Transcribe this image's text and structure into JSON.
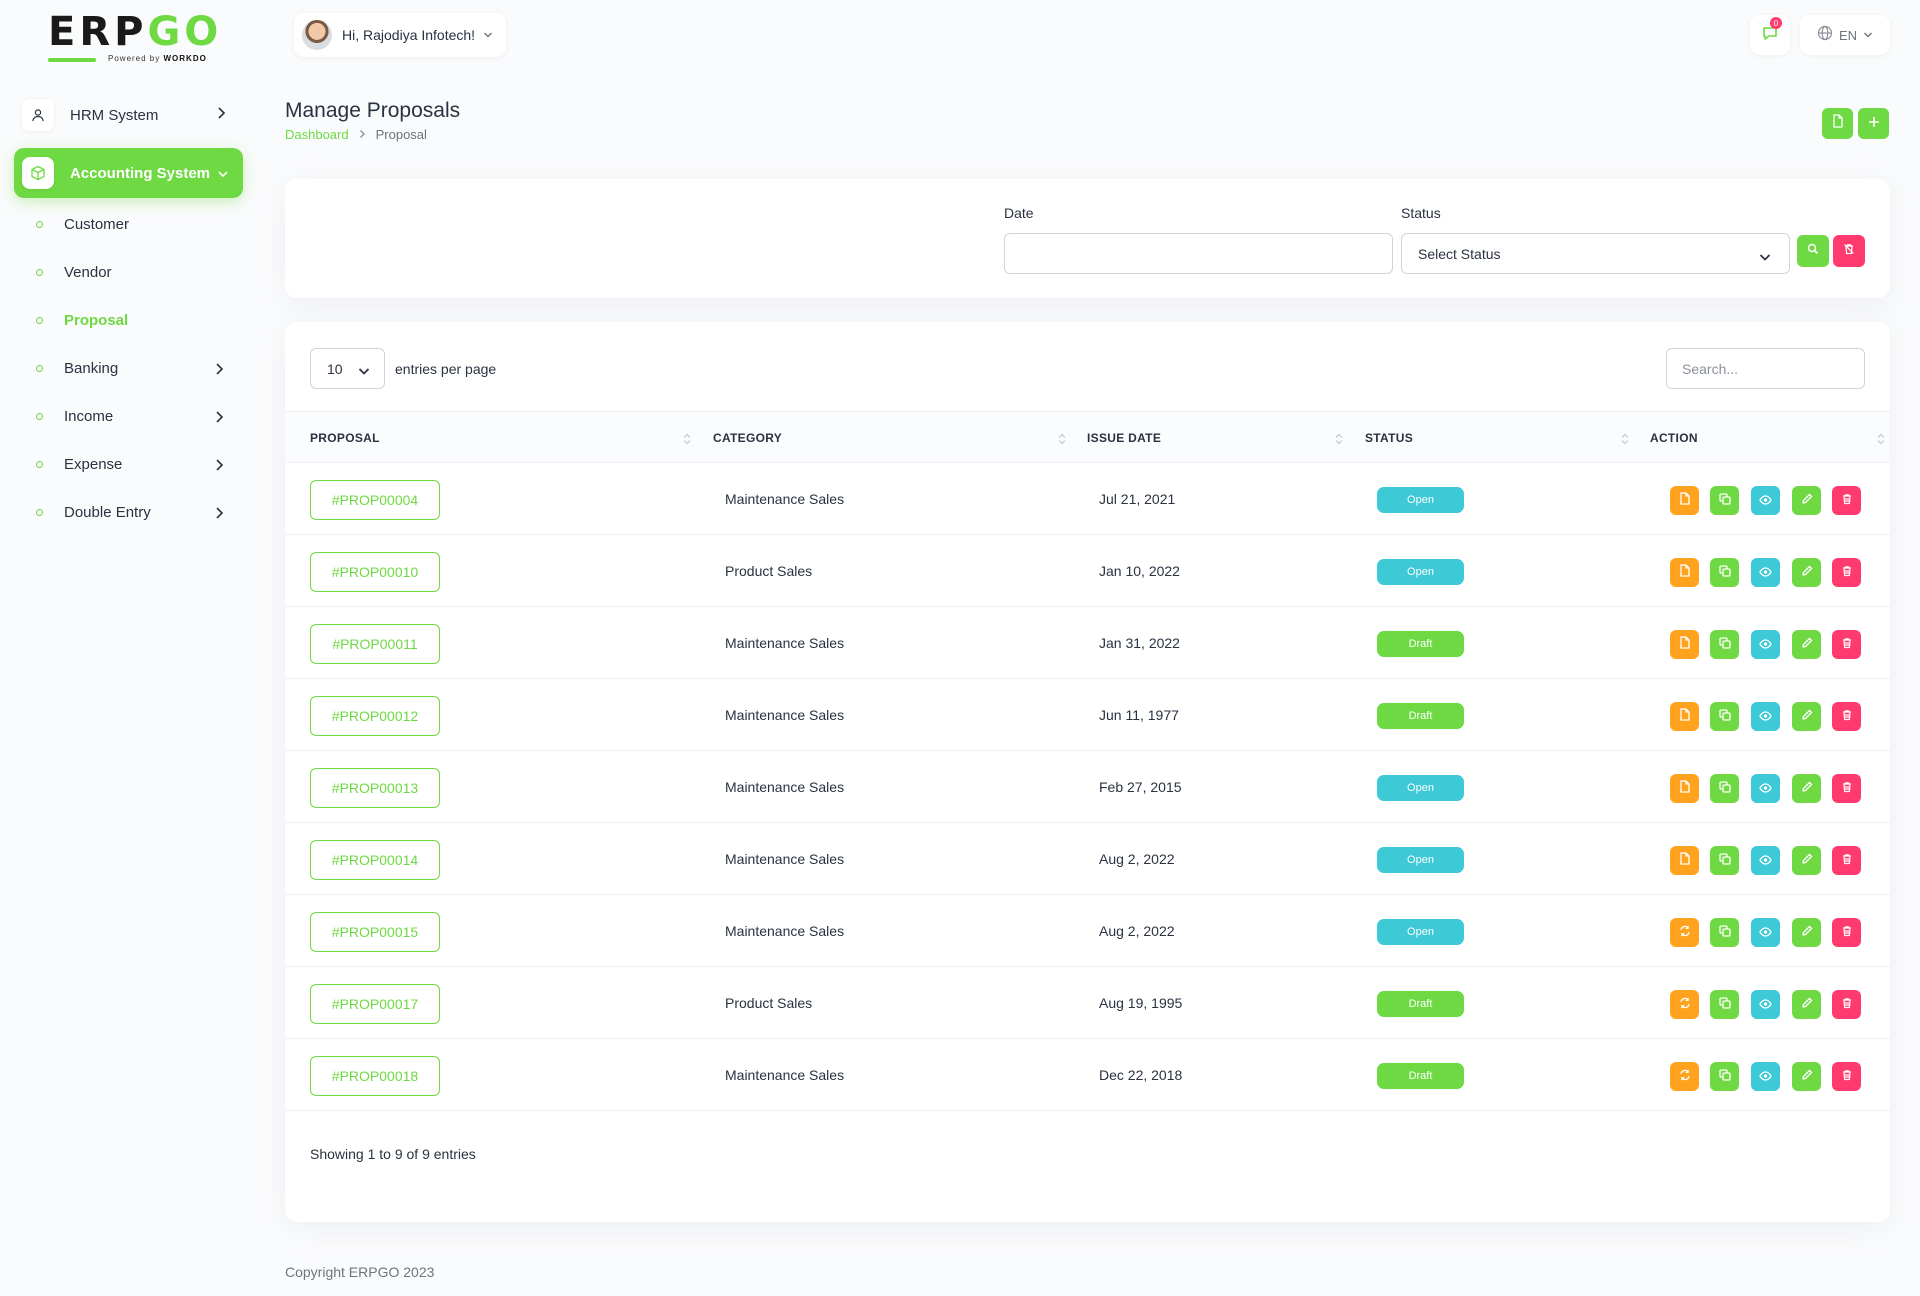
{
  "brand": {
    "logo_main": "ERP",
    "logo_accent": "GO",
    "powered_by": "Powered by",
    "powered_brand": "WORKDO"
  },
  "sidebar": {
    "hrm": "HRM System",
    "accounting": "Accounting System",
    "items": [
      {
        "label": "Customer"
      },
      {
        "label": "Vendor"
      },
      {
        "label": "Proposal"
      },
      {
        "label": "Banking"
      },
      {
        "label": "Income"
      },
      {
        "label": "Expense"
      },
      {
        "label": "Double Entry"
      }
    ]
  },
  "header": {
    "greeting": "Hi, Rajodiya Infotech!",
    "notification_count": "0",
    "language": "EN"
  },
  "page": {
    "title": "Manage Proposals",
    "breadcrumb": {
      "home": "Dashboard",
      "current": "Proposal"
    }
  },
  "filter": {
    "date_label": "Date",
    "date_value": "",
    "status_label": "Status",
    "status_selected": "Select Status"
  },
  "table": {
    "per_page": "10",
    "per_page_label": "entries per page",
    "search_placeholder": "Search...",
    "columns": {
      "proposal": "PROPOSAL",
      "category": "CATEGORY",
      "issue_date": "ISSUE DATE",
      "status": "STATUS",
      "action": "ACTION"
    },
    "rows": [
      {
        "id": "#PROP00004",
        "category": "Maintenance Sales",
        "date": "Jul 21, 2021",
        "status": "Open"
      },
      {
        "id": "#PROP00010",
        "category": "Product Sales",
        "date": "Jan 10, 2022",
        "status": "Open"
      },
      {
        "id": "#PROP00011",
        "category": "Maintenance Sales",
        "date": "Jan 31, 2022",
        "status": "Draft"
      },
      {
        "id": "#PROP00012",
        "category": "Maintenance Sales",
        "date": "Jun 11, 1977",
        "status": "Draft"
      },
      {
        "id": "#PROP00013",
        "category": "Maintenance Sales",
        "date": "Feb 27, 2015",
        "status": "Open"
      },
      {
        "id": "#PROP00014",
        "category": "Maintenance Sales",
        "date": "Aug 2, 2022",
        "status": "Open"
      },
      {
        "id": "#PROP00015",
        "category": "Maintenance Sales",
        "date": "Aug 2, 2022",
        "status": "Open"
      },
      {
        "id": "#PROP00017",
        "category": "Product Sales",
        "date": "Aug 19, 1995",
        "status": "Draft"
      },
      {
        "id": "#PROP00018",
        "category": "Maintenance Sales",
        "date": "Dec 22, 2018",
        "status": "Draft"
      }
    ],
    "footer": "Showing 1 to 9 of 9 entries"
  },
  "copyright": "Copyright ERPGO 2023",
  "colors": {
    "primary": "#6fd943",
    "open": "#3ec9d6",
    "draft": "#6fd943",
    "orange": "#ffa21d",
    "danger": "#ff3a6e",
    "info": "#3ec9d6"
  }
}
